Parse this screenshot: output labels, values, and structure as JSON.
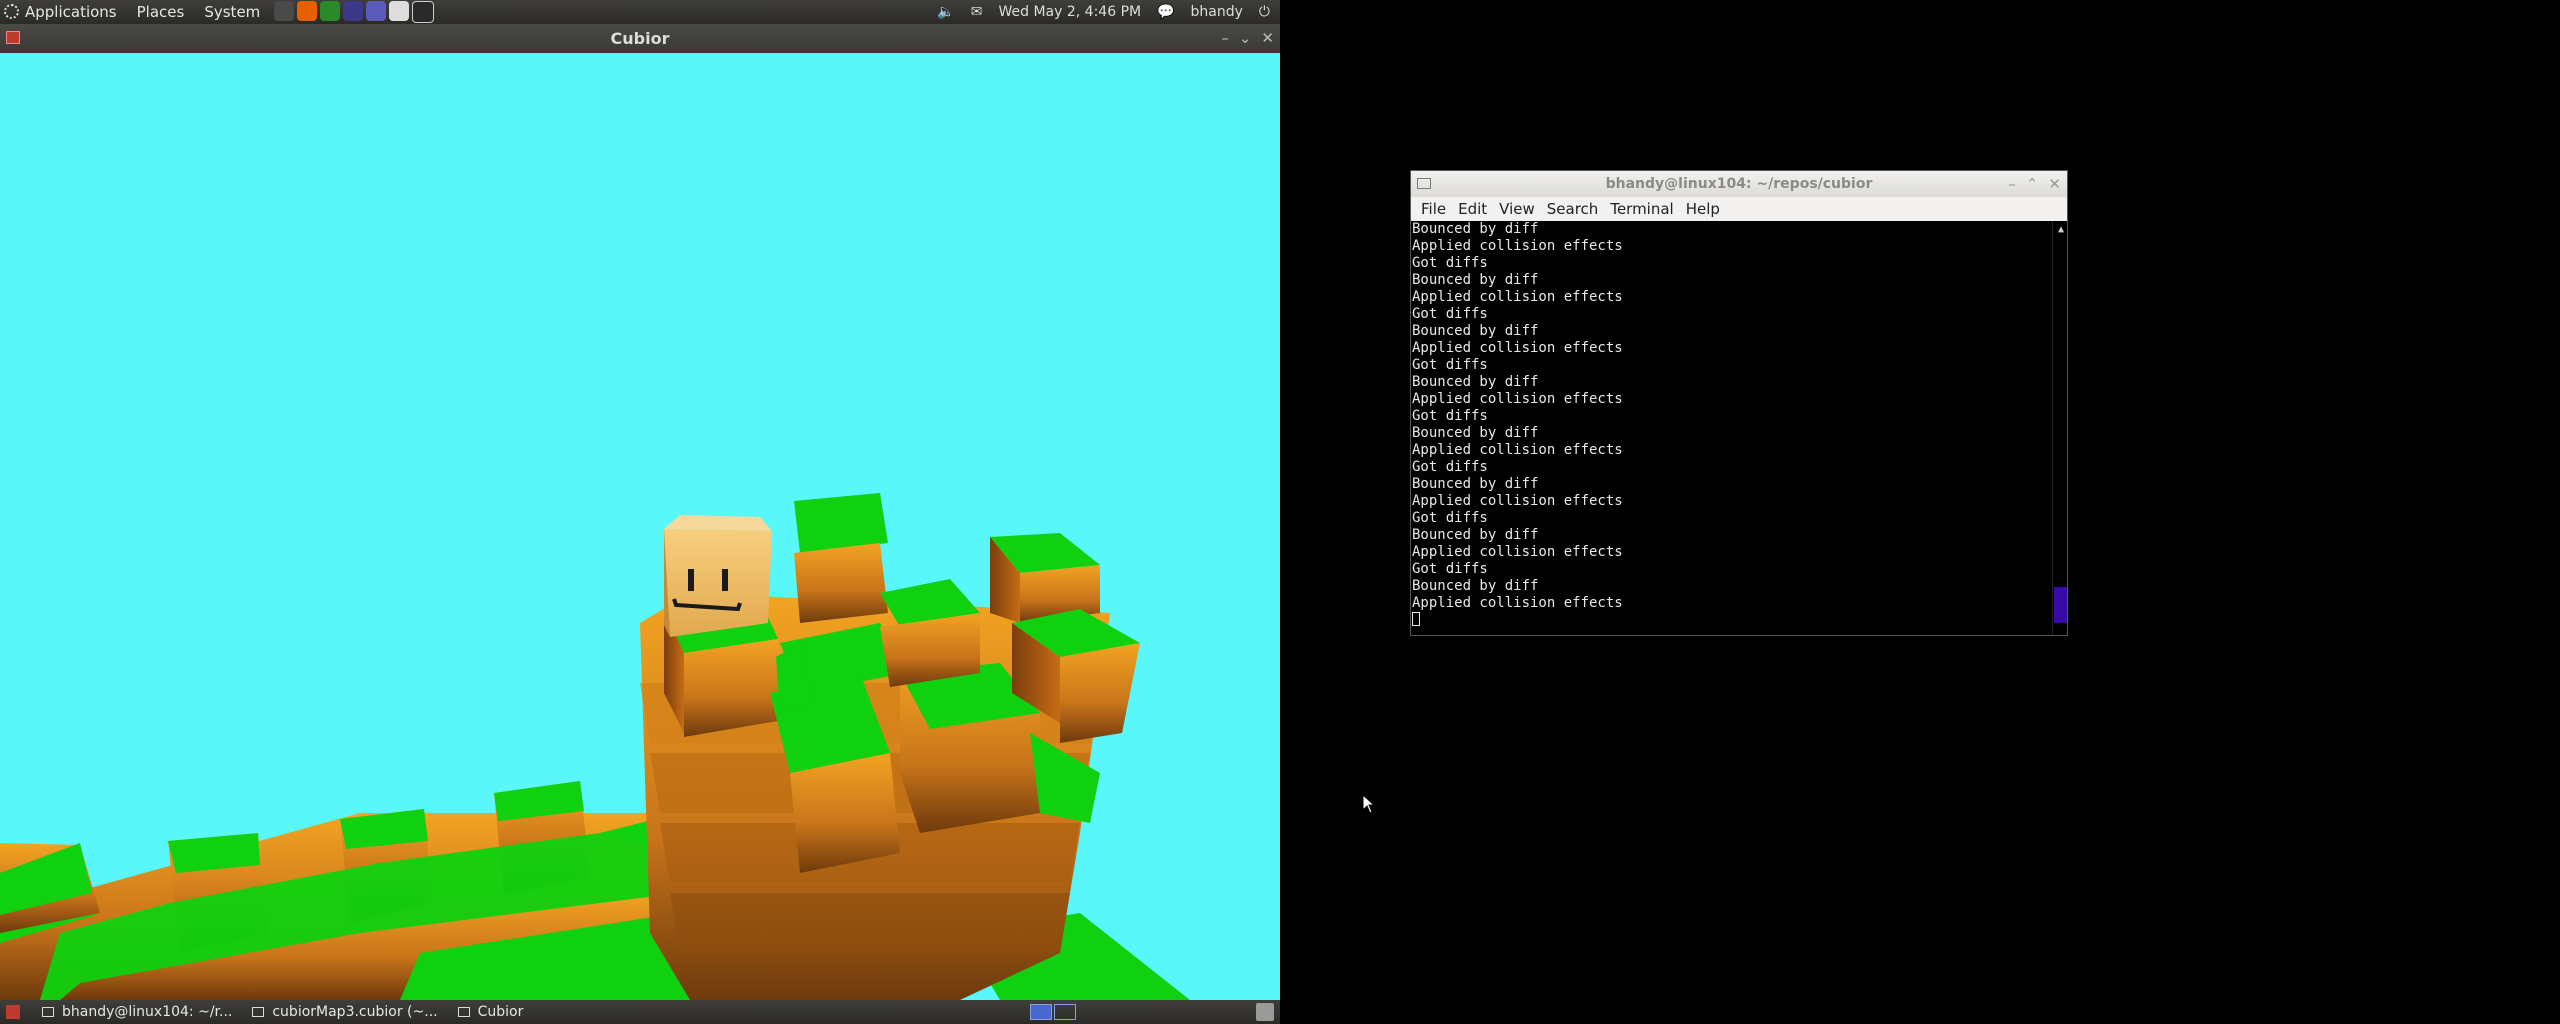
{
  "top_panel": {
    "menus": [
      "Applications",
      "Places",
      "System"
    ],
    "launchers": [
      {
        "icon": "system-monitor-icon",
        "color": "#4a4a4a"
      },
      {
        "icon": "firefox-icon",
        "color": "#e66000"
      },
      {
        "icon": "chrome-icon",
        "color": "#2a8a2a"
      },
      {
        "icon": "eclipse-icon",
        "color": "#3b3a8a"
      },
      {
        "icon": "globe-icon",
        "color": "#5a5ab8"
      },
      {
        "icon": "text-editor-icon",
        "color": "#dddddd"
      },
      {
        "icon": "terminal-icon",
        "color": "#2a2a2a"
      }
    ],
    "volume_icon": "volume-icon",
    "mail_icon": "mail-icon",
    "clock": "Wed May 2, 4:46 PM",
    "chat_icon": "chat-icon",
    "user": "bhandy",
    "power_icon": "power-icon"
  },
  "game_window": {
    "title": "Cubior"
  },
  "bottom_panel": {
    "tasks": [
      {
        "label": "bhandy@linux104: ~/r..."
      },
      {
        "label": "cubiorMap3.cubior (~..."
      },
      {
        "label": "Cubior"
      }
    ],
    "workspaces": 2,
    "active_workspace": 1
  },
  "terminal": {
    "title": "bhandy@linux104: ~/repos/cubior",
    "menu": [
      "File",
      "Edit",
      "View",
      "Search",
      "Terminal",
      "Help"
    ],
    "lines": [
      "Bounced by diff",
      "Applied collision effects",
      "Got diffs",
      "Bounced by diff",
      "Applied collision effects",
      "Got diffs",
      "Bounced by diff",
      "Applied collision effects",
      "Got diffs",
      "Bounced by diff",
      "Applied collision effects",
      "Got diffs",
      "Bounced by diff",
      "Applied collision effects",
      "Got diffs",
      "Bounced by diff",
      "Applied collision effects",
      "Got diffs",
      "Bounced by diff",
      "Applied collision effects",
      "Got diffs",
      "Bounced by diff",
      "Applied collision effects"
    ]
  },
  "colors": {
    "sky": "#5af7fa",
    "grass": "#0fd10f",
    "dirt": "#e08a1a",
    "scrollbar_thumb": "#3a0aa8"
  }
}
